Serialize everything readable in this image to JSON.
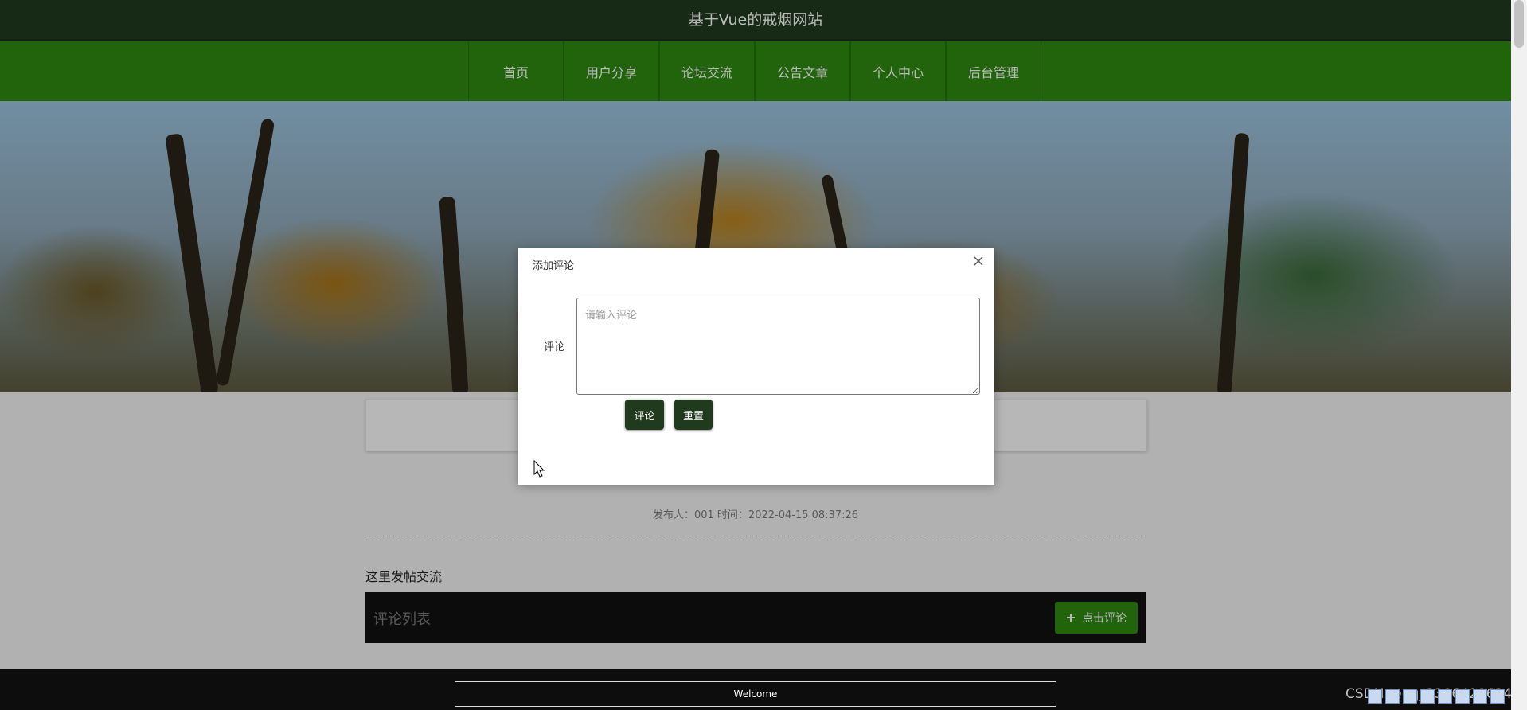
{
  "header": {
    "site_title": "基于Vue的戒烟网站"
  },
  "nav": {
    "items": [
      "首页",
      "用户分享",
      "论坛交流",
      "公告文章",
      "个人中心",
      "后台管理"
    ]
  },
  "post": {
    "meta": "发布人：001 时间：2022-04-15 08:37:26"
  },
  "forum": {
    "section_title": "这里发帖交流",
    "comment_list_label": "评论列表",
    "add_comment_button": "点击评论"
  },
  "dialog": {
    "title": "添加评论",
    "comment_label": "评论",
    "comment_placeholder": "请输入评论",
    "comment_value": "",
    "submit_label": "评论",
    "reset_label": "重置"
  },
  "footer": {
    "welcome": "Welcome"
  },
  "watermark": "CSDN @qq_3306428634",
  "colors": {
    "header_bg": "#1f3a1d",
    "nav_bg": "#2f8a11",
    "button_dark": "#1f3a1d",
    "button_green": "#2f8a11",
    "footer_bg": "#0d0d0d"
  },
  "icons": [
    "close-icon",
    "plus-icon",
    "cursor-icon",
    "tray-icon"
  ]
}
